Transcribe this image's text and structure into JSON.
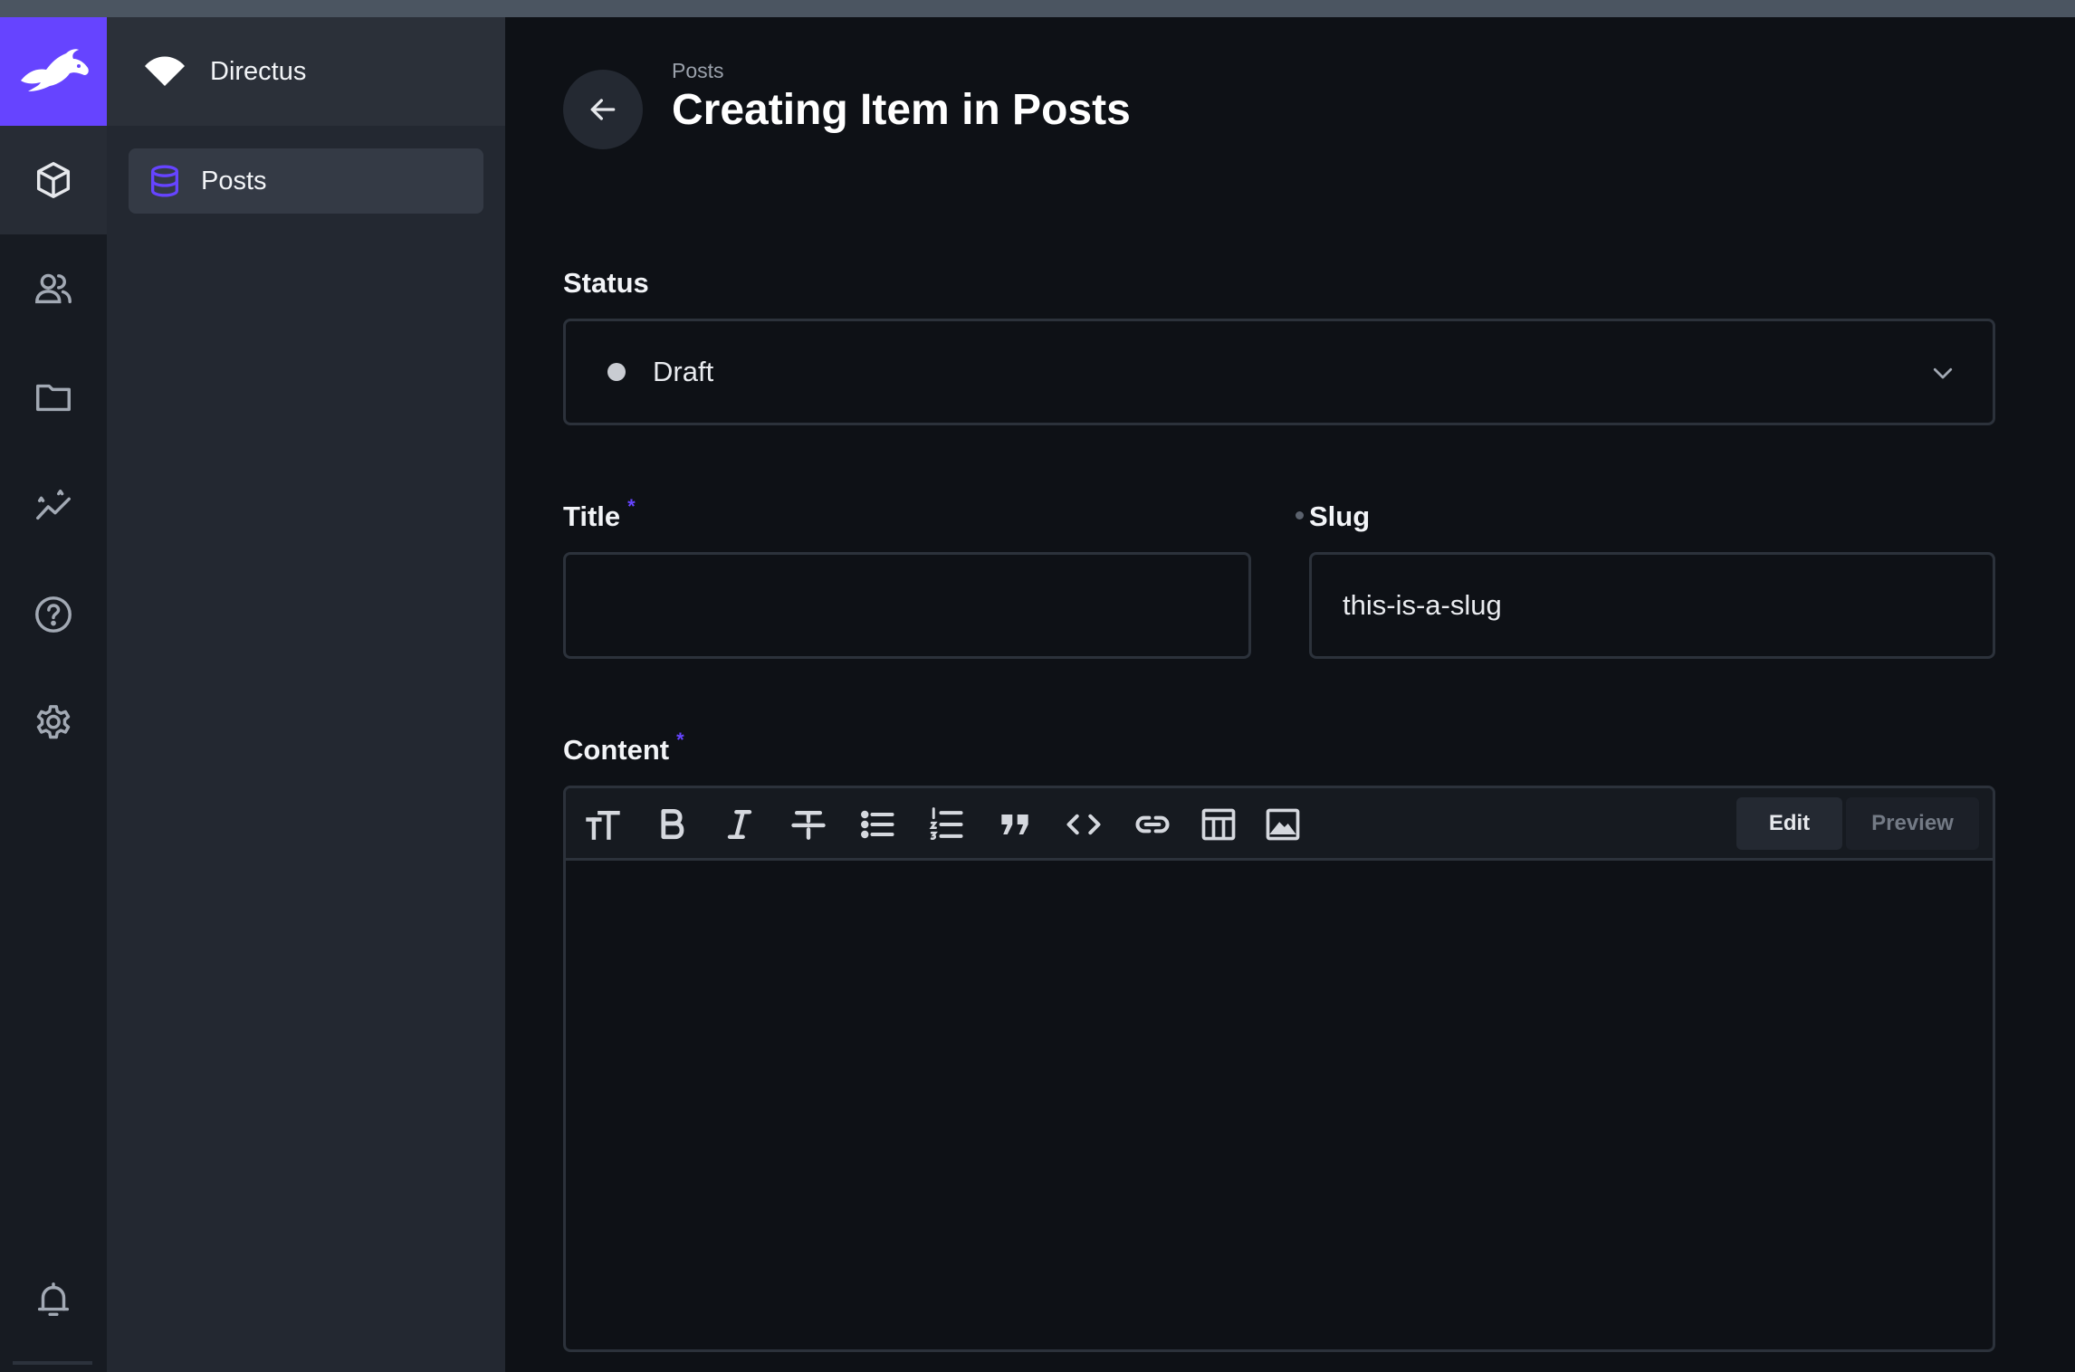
{
  "app": {
    "project_name": "Directus",
    "accent_color": "#6644ff"
  },
  "rail": {
    "items": [
      {
        "icon": "cube-icon",
        "label": "Content",
        "active": true
      },
      {
        "icon": "users-icon",
        "label": "User Directory",
        "active": false
      },
      {
        "icon": "folder-icon",
        "label": "File Library",
        "active": false
      },
      {
        "icon": "insights-icon",
        "label": "Insights",
        "active": false
      },
      {
        "icon": "help-icon",
        "label": "Documentation",
        "active": false
      },
      {
        "icon": "gear-icon",
        "label": "Settings",
        "active": false
      }
    ],
    "bottom_icon": "bell-icon"
  },
  "nav": {
    "collections": [
      {
        "label": "Posts",
        "icon": "database-icon",
        "active": true
      }
    ]
  },
  "header": {
    "breadcrumb": "Posts",
    "title": "Creating Item in Posts"
  },
  "form": {
    "status": {
      "label": "Status",
      "value": "Draft"
    },
    "title": {
      "label": "Title",
      "required_mark": "*",
      "value": ""
    },
    "slug": {
      "label": "Slug",
      "value": "this-is-a-slug"
    },
    "content": {
      "label": "Content",
      "required_mark": "*",
      "toolbar": [
        "heading-icon",
        "bold-icon",
        "italic-icon",
        "strikethrough-icon",
        "bullet-list-icon",
        "numbered-list-icon",
        "blockquote-icon",
        "code-icon",
        "link-icon",
        "table-icon",
        "image-icon"
      ],
      "edit_label": "Edit",
      "preview_label": "Preview",
      "value": ""
    }
  }
}
